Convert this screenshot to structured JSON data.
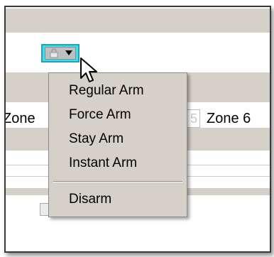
{
  "arm_control": {
    "icon": "lock-icon",
    "dropdown_icon": "caret-down-icon",
    "accent_color": "#36e2f0"
  },
  "zones": {
    "left_label": "Zone",
    "partial_value": "5",
    "right_label": "Zone 6"
  },
  "arm_menu": {
    "items": [
      "Regular Arm",
      "Force Arm",
      "Stay Arm",
      "Instant Arm"
    ],
    "disarm_label": "Disarm"
  },
  "cursor": {
    "icon": "mouse-pointer-icon"
  }
}
